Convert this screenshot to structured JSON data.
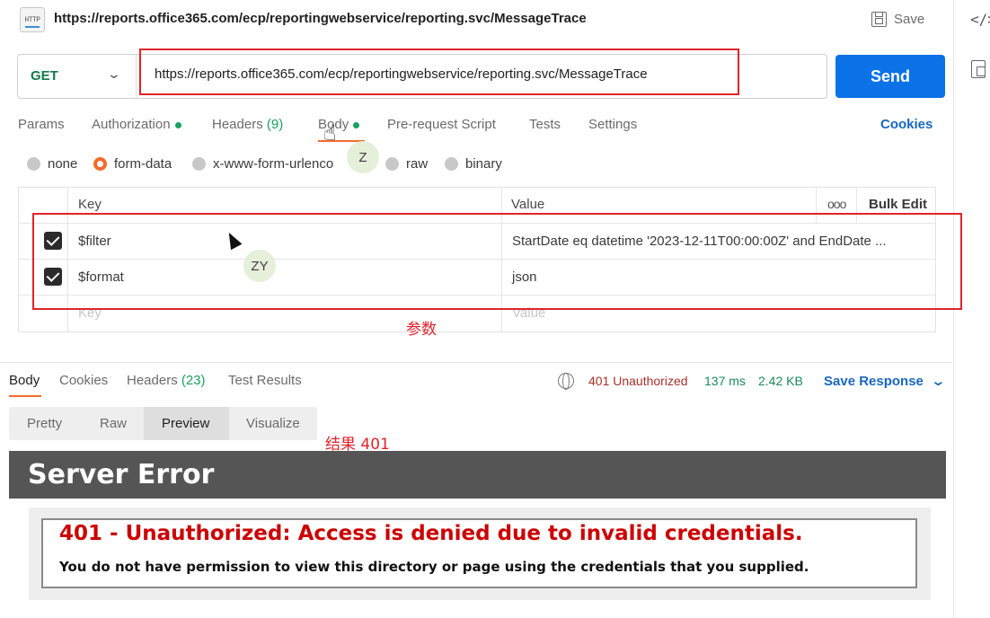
{
  "header": {
    "icon_label": "HTTP",
    "request_title": "https://reports.office365.com/ecp/reportingwebservice/reporting.svc/MessageTrace",
    "save_label": "Save"
  },
  "right_rail": {
    "code_icon": "</>"
  },
  "url_bar": {
    "method": "GET",
    "url": "https://reports.office365.com/ecp/reportingwebservice/reporting.svc/MessageTrace",
    "send_label": "Send"
  },
  "request_tabs": {
    "params": "Params",
    "authorization": "Authorization",
    "headers": "Headers",
    "headers_count": "(9)",
    "body": "Body",
    "pre_request": "Pre-request Script",
    "tests": "Tests",
    "settings": "Settings",
    "cookies": "Cookies"
  },
  "body_types": {
    "none": "none",
    "form_data": "form-data",
    "urlencoded": "x-www-form-urlenco",
    "raw": "raw",
    "binary": "binary",
    "selected": "form-data"
  },
  "params_table": {
    "key_header": "Key",
    "value_header": "Value",
    "menu_glyph": "ooo",
    "bulk_edit": "Bulk Edit",
    "rows": [
      {
        "checked": true,
        "key": "$filter",
        "value": "StartDate eq datetime '2023-12-11T00:00:00Z' and EndDate ..."
      },
      {
        "checked": true,
        "key": "$format",
        "value": "json"
      }
    ],
    "key_placeholder": "Key",
    "value_placeholder": "Value"
  },
  "annotations": {
    "params_label": "参数",
    "result_label": "结果 401",
    "bubble_z": "Z",
    "bubble_zy": "ZY"
  },
  "response": {
    "tabs": {
      "body": "Body",
      "cookies": "Cookies",
      "headers": "Headers",
      "headers_count": "(23)",
      "test_results": "Test Results"
    },
    "status": "401 Unauthorized",
    "time": "137 ms",
    "size": "2.42 KB",
    "save_response": "Save Response",
    "views": [
      "Pretty",
      "Raw",
      "Preview",
      "Visualize"
    ],
    "active_view": "Preview"
  },
  "preview": {
    "title": "Server Error",
    "error_heading": "401 - Unauthorized: Access is denied due to invalid credentials.",
    "error_message": "You do not have permission to view this directory or page using the credentials that you supplied."
  },
  "colors": {
    "send_blue": "#0b72e7",
    "method_green": "#0f7b4a",
    "accent_orange": "#f36b2b",
    "status_red": "#a6322a",
    "meta_green": "#1a8a5a",
    "annotation_red": "#e0242a",
    "error_red": "#cc0000"
  }
}
